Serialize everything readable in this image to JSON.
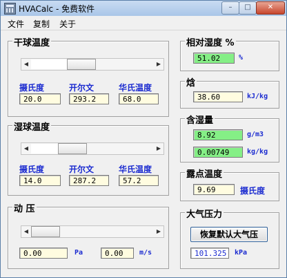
{
  "window": {
    "title": "HVACalc - 免费软件",
    "buttons": {
      "minimize": "–",
      "maximize": "□",
      "close": "✕"
    }
  },
  "menu": [
    {
      "label": "文件"
    },
    {
      "label": "复制"
    },
    {
      "label": "关于"
    }
  ],
  "dry_bulb": {
    "title": "干球温度",
    "label_c": "摄氏度",
    "label_k": "开尔文",
    "label_f": "华氏温度",
    "celsius": "20.0",
    "kelvin": "293.2",
    "fahrenheit": "68.0",
    "slider_fraction": 0.38
  },
  "wet_bulb": {
    "title": "湿球温度",
    "label_c": "摄氏度",
    "label_k": "开尔文",
    "label_f": "华氏温度",
    "celsius": "14.0",
    "kelvin": "287.2",
    "fahrenheit": "57.2",
    "slider_fraction": 0.28
  },
  "dynamic_pressure": {
    "title": "动 压",
    "pressure": "0.00",
    "pressure_unit": "Pa",
    "velocity": "0.00",
    "velocity_unit": "m/s",
    "slider_fraction": 0.0
  },
  "relative_humidity": {
    "title": "相对湿度 %",
    "value": "51.02",
    "unit": "%"
  },
  "enthalpy": {
    "title": "焓",
    "value": "38.60",
    "unit": "kJ/kg"
  },
  "moisture_content": {
    "title": "含湿量",
    "value_gm3": "8.92",
    "unit_gm3": "g/m3",
    "value_kgkg": "0.00749",
    "unit_kgkg": "kg/kg"
  },
  "dew_point": {
    "title": "露点温度",
    "value": "9.69",
    "unit": "摄氏度"
  },
  "atmospheric": {
    "title": "大气压力",
    "reset_button": "恢复默认大气压",
    "value": "101.325",
    "unit": "kPa"
  },
  "colors": {
    "label_blue": "#1b2bd0",
    "field_yellow": "#fffce0",
    "field_green": "#85ef86"
  }
}
